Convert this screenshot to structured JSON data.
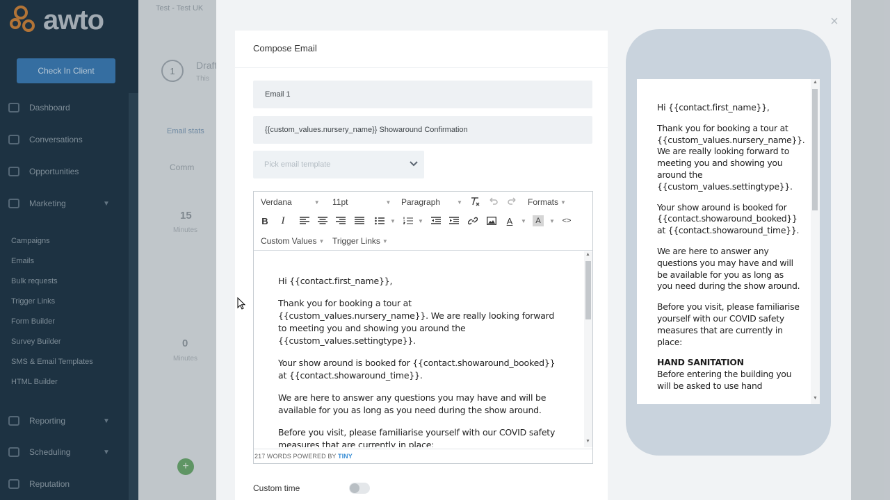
{
  "app": {
    "logo_text": "awto",
    "breadcrumb": "Test - Test UK",
    "checkin_label": "Check In Client",
    "nav": [
      {
        "label": "Dashboard",
        "icon": "dashboard-icon"
      },
      {
        "label": "Conversations",
        "icon": "chat-icon"
      },
      {
        "label": "Opportunities",
        "icon": "filter-icon"
      },
      {
        "label": "Marketing",
        "icon": "mail-icon"
      },
      {
        "label": "Reporting",
        "icon": "chart-icon"
      },
      {
        "label": "Scheduling",
        "icon": "calendar-icon"
      },
      {
        "label": "Reputation",
        "icon": "star-icon"
      }
    ],
    "marketing_sub": [
      "Campaigns",
      "Emails",
      "Bulk requests",
      "Trigger Links",
      "Form Builder",
      "Survey Builder",
      "SMS & Email Templates",
      "HTML Builder"
    ],
    "bg_step": "1",
    "bg_draft": "Draft",
    "bg_sub": "This",
    "bg_email_stats": "Email stats",
    "bg_comm": "Comm",
    "bg_stat1_value": "15",
    "bg_stat1_label": "Minutes",
    "bg_stat2_value": "0",
    "bg_stat2_label": "Minutes",
    "bg_add": "+"
  },
  "modal": {
    "close": "×",
    "compose_title": "Compose Email",
    "email_name": "Email 1",
    "subject": "{{custom_values.nursery_name}} Showaround Confirmation",
    "template_placeholder": "Pick email template",
    "toolbar": {
      "font": "Verdana",
      "size": "11pt",
      "block": "Paragraph",
      "formats": "Formats",
      "custom_values": "Custom Values",
      "trigger_links": "Trigger Links",
      "bold": "B",
      "italic": "I",
      "font_color": "A",
      "bg_color": "A",
      "code": "<>"
    },
    "body": [
      "Hi {{contact.first_name}},",
      "Thank you for booking a tour at {{custom_values.nursery_name}}. We are really looking forward to meeting you and showing you around the {{custom_values.settingtype}}.",
      "Your show around is booked for {{contact.showaround_booked}} at {{contact.showaround_time}}.",
      "We are here to answer any questions you may have and will be available for you as long as you need during the show around.",
      "Before you visit, please familiarise yourself with our COVID safety measures that are currently in place:"
    ],
    "status_words": "217 WORDS POWERED BY ",
    "status_tiny": "TINY",
    "custom_time_label": "Custom time",
    "preview": [
      "Hi {{contact.first_name}},",
      "Thank you for booking a tour at {{custom_values.nursery_name}}. We are really looking forward to meeting you and showing you around the {{custom_values.settingtype}}.",
      "Your show around is booked for {{contact.showaround_booked}} at {{contact.showaround_time}}.",
      "We are here to answer any questions you may have and will be available for you as long as you need during the show around.",
      "Before you visit, please familiarise yourself with our COVID safety measures that are currently in place:"
    ],
    "preview_heading": "HAND SANITATION",
    "preview_after_heading": "Before entering the building you will be asked to use hand"
  }
}
